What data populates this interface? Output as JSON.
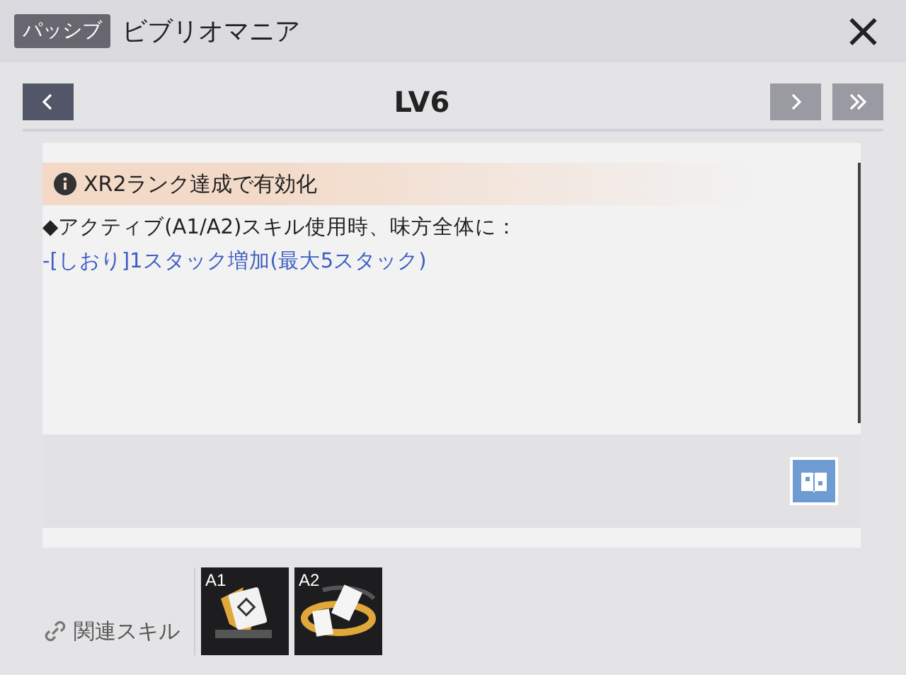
{
  "header": {
    "badge": "パッシブ",
    "title": "ビブリオマニア",
    "close": "×"
  },
  "nav": {
    "level": "LV6",
    "buttons": [
      {
        "kind": "prev",
        "disabled": false
      },
      {
        "kind": "next",
        "disabled": true
      },
      {
        "kind": "last",
        "disabled": true
      }
    ]
  },
  "notice": "XR2ランク達成で有効化",
  "description": [
    "◆アクティブ(A1/A2)スキル使用時、味方全体に：",
    "-[しおり]1スタック増加(最大5スタック)"
  ],
  "related": {
    "label": "関連スキル",
    "skills": [
      {
        "label": "A1",
        "kind": "book"
      },
      {
        "label": "A2",
        "kind": "cards"
      }
    ]
  }
}
